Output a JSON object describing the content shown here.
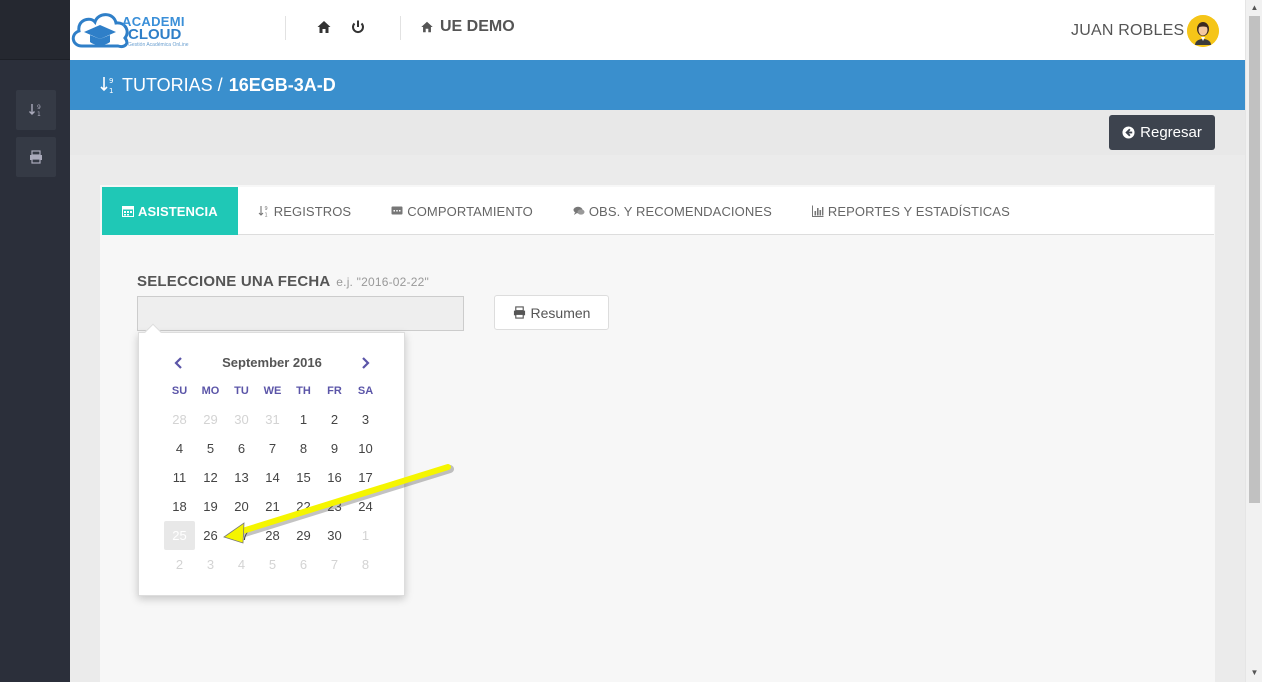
{
  "header": {
    "logo": {
      "line1": "ACADEMI",
      "line2": "CLOUD",
      "tagline": "Gestión Académica OnLine"
    },
    "school": "UE DEMO",
    "user_name": "JUAN ROBLES"
  },
  "titlebar": {
    "section": "TUTORIAS /",
    "course": "16EGB-3A-D"
  },
  "actions": {
    "back_label": "Regresar"
  },
  "tabs": [
    {
      "label": "ASISTENCIA",
      "icon": "calendar-icon",
      "active": true
    },
    {
      "label": "REGISTROS",
      "icon": "sort-numeric-icon",
      "active": false
    },
    {
      "label": "COMPORTAMIENTO",
      "icon": "comment-icon",
      "active": false
    },
    {
      "label": "OBS. Y RECOMENDACIONES",
      "icon": "comments-icon",
      "active": false
    },
    {
      "label": "REPORTES Y ESTADÍSTICAS",
      "icon": "bar-chart-icon",
      "active": false
    }
  ],
  "form": {
    "date_label": "SELECCIONE UNA FECHA",
    "date_hint": "e.j. \"2016-02-22\"",
    "date_value": "",
    "summary_label": "Resumen"
  },
  "datepicker": {
    "month_title": "September 2016",
    "weekdays": [
      "SU",
      "MO",
      "TU",
      "WE",
      "TH",
      "FR",
      "SA"
    ],
    "weeks": [
      [
        {
          "d": "28",
          "m": true
        },
        {
          "d": "29",
          "m": true
        },
        {
          "d": "30",
          "m": true
        },
        {
          "d": "31",
          "m": true
        },
        {
          "d": "1"
        },
        {
          "d": "2"
        },
        {
          "d": "3"
        }
      ],
      [
        {
          "d": "4"
        },
        {
          "d": "5"
        },
        {
          "d": "6"
        },
        {
          "d": "7"
        },
        {
          "d": "8"
        },
        {
          "d": "9"
        },
        {
          "d": "10"
        }
      ],
      [
        {
          "d": "11"
        },
        {
          "d": "12"
        },
        {
          "d": "13"
        },
        {
          "d": "14"
        },
        {
          "d": "15"
        },
        {
          "d": "16"
        },
        {
          "d": "17"
        }
      ],
      [
        {
          "d": "18"
        },
        {
          "d": "19"
        },
        {
          "d": "20"
        },
        {
          "d": "21"
        },
        {
          "d": "22"
        },
        {
          "d": "23"
        },
        {
          "d": "24"
        }
      ],
      [
        {
          "d": "25",
          "s": true
        },
        {
          "d": "26"
        },
        {
          "d": "27"
        },
        {
          "d": "28"
        },
        {
          "d": "29"
        },
        {
          "d": "30"
        },
        {
          "d": "1",
          "m": true
        }
      ],
      [
        {
          "d": "2",
          "m": true
        },
        {
          "d": "3",
          "m": true
        },
        {
          "d": "4",
          "m": true
        },
        {
          "d": "5",
          "m": true
        },
        {
          "d": "6",
          "m": true
        },
        {
          "d": "7",
          "m": true
        },
        {
          "d": "8",
          "m": true
        }
      ]
    ]
  },
  "colors": {
    "accent_blue": "#3a8fcd",
    "tab_active": "#1fc8b6",
    "sidebar": "#2b2f3a",
    "annotation_arrow": "#f5f500"
  }
}
